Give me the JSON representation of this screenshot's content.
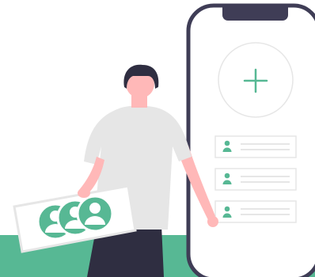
{
  "illustration": {
    "subject": "person-holding-contact-card-beside-phone",
    "colors": {
      "accent": "#57b894",
      "dark": "#2f2e41",
      "skin": "#ffb8b8",
      "shirt": "#e6e6e6",
      "phone_outline": "#3f3d56",
      "line": "#e6e6e6"
    },
    "phone": {
      "add_icon": "plus-icon",
      "contact_rows": [
        {
          "icon": "user-icon"
        },
        {
          "icon": "user-icon"
        },
        {
          "icon": "user-icon"
        }
      ]
    },
    "card": {
      "avatars": [
        "user-icon",
        "user-icon",
        "user-icon"
      ]
    }
  }
}
